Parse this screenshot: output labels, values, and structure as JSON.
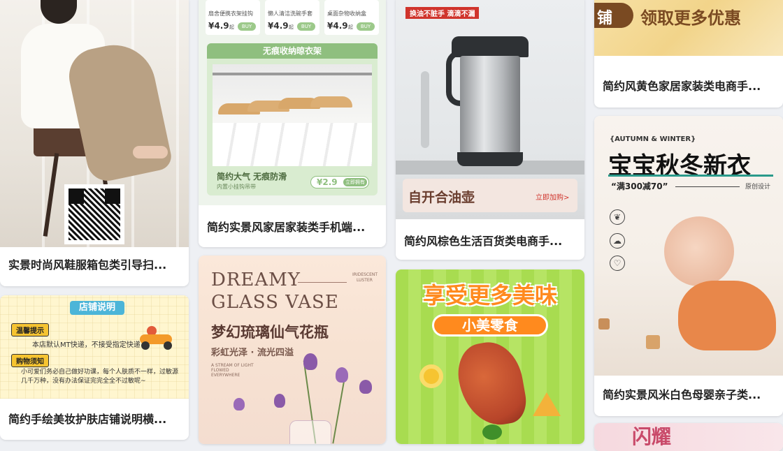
{
  "cards": {
    "fashion": {
      "caption": "实景时尚风鞋服箱包类引导扫..."
    },
    "beauty": {
      "caption": "简约手绘美妆护肤店铺说明横...",
      "banner_title": "店铺说明",
      "notice1_title": "温馨提示",
      "notice1_text": "本店默认MT快递，不接受指定快递",
      "notice2_title": "购物须知",
      "notice2_text": "小可爱们务必自己做好功课，每个人肤质不一样，过敏源几千万种，没有办法保证完完全全不过敏呢~"
    },
    "home": {
      "caption": "简约实景风家居家装类手机端...",
      "products": [
        {
          "name": "扇舍便携衣架挂钩",
          "price": "¥4.9",
          "unit": "起",
          "buy": "BUY"
        },
        {
          "name": "懒人清洁洗碗手套",
          "price": "¥4.9",
          "unit": "起",
          "buy": "BUY"
        },
        {
          "name": "桌面杂物收纳盒",
          "price": "¥4.9",
          "unit": "起",
          "buy": "BUY"
        }
      ],
      "section_title": "无痕收纳晾衣架",
      "slogan": "简约大气 无痕防滑",
      "sub": "内置小挂钩吊带",
      "price": "¥2.9",
      "cta": "立即拥有"
    },
    "vase": {
      "title_en1": "DREAMY",
      "title_en2": "GLASS VASE",
      "side_en1": "IRIDESCENT",
      "side_en2": "LUSTER",
      "title_cn": "梦幻琉璃仙气花瓶",
      "sub_cn": "彩虹光泽 · 流光四溢",
      "small_en1": "A STREAM OF LIGHT",
      "small_en2": "FLOWED",
      "small_en3": "EVERYWHERE"
    },
    "kettle": {
      "tag": "换油不脏手 滴滴不漏",
      "name": "自开合油壶",
      "cta": "立即加购>",
      "caption": "简约风棕色生活百货类电商手..."
    },
    "snack": {
      "headline": "享受更多美味",
      "pill": "小美零食"
    },
    "yellow": {
      "left_text": "铺",
      "right_text": "领取更多优惠",
      "caption": "简约风黄色家居家装类电商手..."
    },
    "baby": {
      "season_en": "{AUTUMN & WINTER}",
      "title": "宝宝秋冬新衣",
      "promo": "“满300减70”",
      "design": "原创设计",
      "caption": "简约实景风米白色母婴亲子类..."
    },
    "pink": {
      "text": "闪耀"
    }
  },
  "colors": {
    "page_bg": "#eef0f4",
    "home_green": "#8fbf7f",
    "kettle_red": "#d0342c",
    "snack_green": "#a8dc50",
    "snack_orange": "#ff8a1e",
    "yellow_gold": "#f2d48a",
    "baby_cream": "#f5efe8"
  }
}
